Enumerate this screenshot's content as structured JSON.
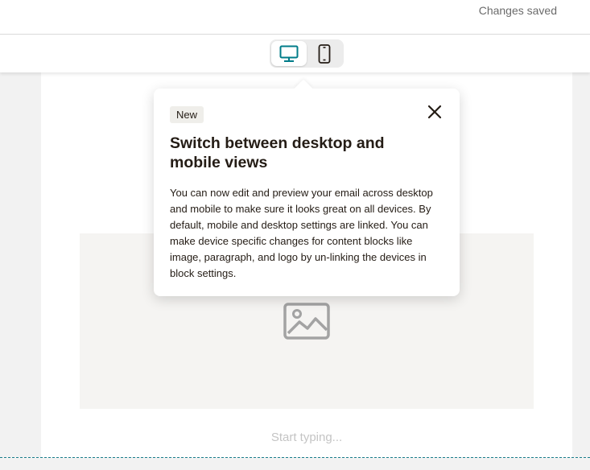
{
  "header": {
    "status": "Changes saved"
  },
  "toolbar": {
    "desktop_icon": "desktop-icon",
    "mobile_icon": "mobile-icon",
    "accent_color": "#007c89"
  },
  "canvas": {
    "image_icon": "image-icon",
    "text_placeholder": "Start typing..."
  },
  "popover": {
    "badge": "New",
    "close_icon": "close-icon",
    "title": "Switch between desktop and mobile views",
    "body": "You can now edit and preview your email across desktop and mobile to make sure it looks great on all devices. By default, mobile and desktop settings are linked. You can make device specific changes for content blocks like image, paragraph, and logo by un-linking the devices in block settings."
  }
}
